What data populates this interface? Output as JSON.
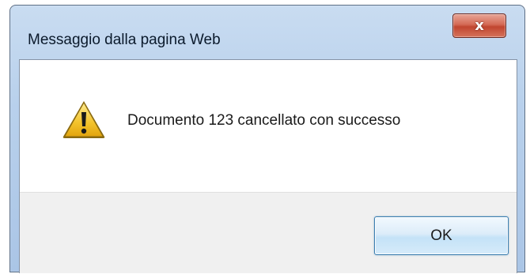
{
  "window": {
    "title": "Messaggio dalla pagina Web",
    "close_label": "x"
  },
  "message": {
    "icon": "warning-icon",
    "text": "Documento 123 cancellato con successo"
  },
  "buttons": {
    "ok_label": "OK"
  },
  "colors": {
    "warning_fill": "#f3c22b",
    "close_button": "#c9523e",
    "ok_border": "#3c7fb1"
  }
}
